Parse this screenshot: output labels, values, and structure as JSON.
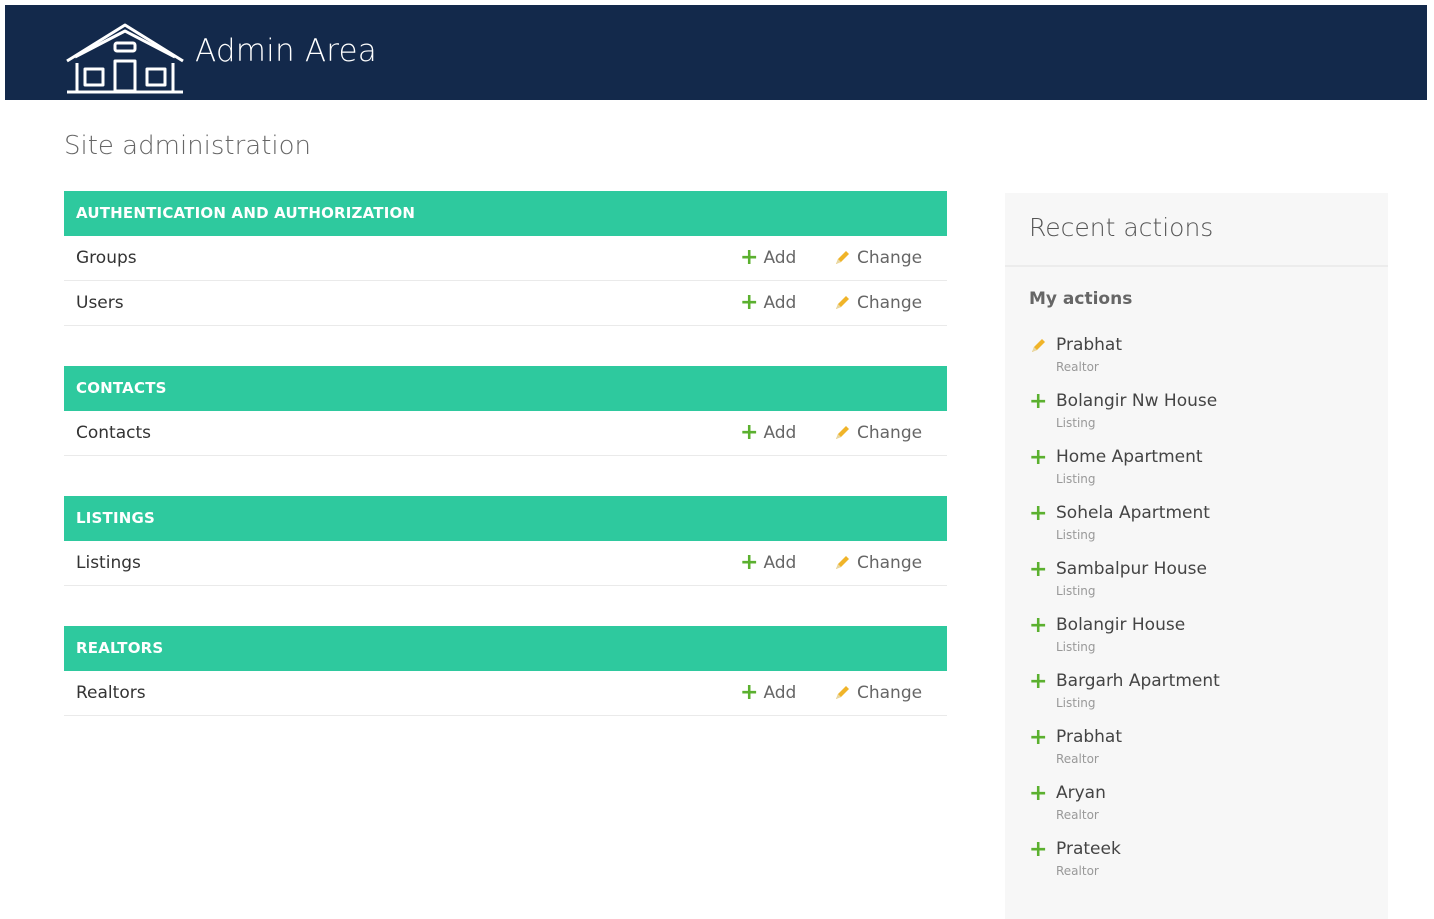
{
  "header": {
    "brand": "Admin Area"
  },
  "page_title": "Site administration",
  "modules": [
    {
      "title": "AUTHENTICATION AND AUTHORIZATION",
      "models": [
        "Groups",
        "Users"
      ]
    },
    {
      "title": "CONTACTS",
      "models": [
        "Contacts"
      ]
    },
    {
      "title": "LISTINGS",
      "models": [
        "Listings"
      ]
    },
    {
      "title": "REALTORS",
      "models": [
        "Realtors"
      ]
    }
  ],
  "row_actions": {
    "add_label": "Add",
    "change_label": "Change"
  },
  "recent": {
    "title": "Recent actions",
    "subtitle": "My actions",
    "items": [
      {
        "icon": "pencil-icon",
        "name": "Prabhat",
        "type": "Realtor"
      },
      {
        "icon": "plus-icon",
        "name": "Bolangir Nw House",
        "type": "Listing"
      },
      {
        "icon": "plus-icon",
        "name": "Home Apartment",
        "type": "Listing"
      },
      {
        "icon": "plus-icon",
        "name": "Sohela Apartment",
        "type": "Listing"
      },
      {
        "icon": "plus-icon",
        "name": "Sambalpur House",
        "type": "Listing"
      },
      {
        "icon": "plus-icon",
        "name": "Bolangir House",
        "type": "Listing"
      },
      {
        "icon": "plus-icon",
        "name": "Bargarh Apartment",
        "type": "Listing"
      },
      {
        "icon": "plus-icon",
        "name": "Prabhat",
        "type": "Realtor"
      },
      {
        "icon": "plus-icon",
        "name": "Aryan",
        "type": "Realtor"
      },
      {
        "icon": "plus-icon",
        "name": "Prateek",
        "type": "Realtor"
      }
    ]
  },
  "colors": {
    "header_bg": "#13294b",
    "module_header": "#2ec99e",
    "add_icon": "#5bb02f",
    "change_icon": "#f0b429"
  }
}
